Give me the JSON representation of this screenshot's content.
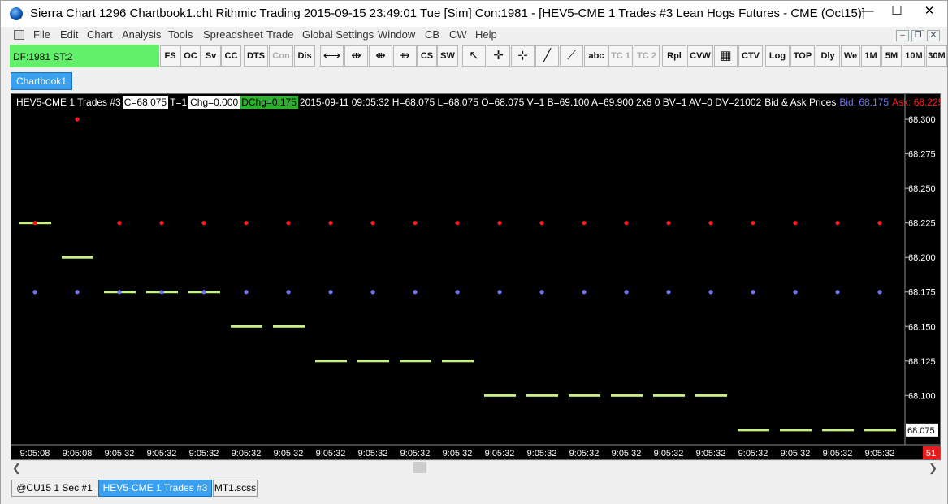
{
  "window": {
    "title": "Sierra Chart 1296 Chartbook1.cht  Rithmic Trading 2015-09-15  23:49:01 Tue [Sim]  Con:1981 - [HEV5-CME  1 Trades  #3  Lean Hogs Futures - CME (Oct15)]",
    "minimize": "—",
    "maximize": "☐",
    "close": "✕"
  },
  "menu": {
    "items": [
      "File",
      "Edit",
      "Chart",
      "Analysis",
      "Tools",
      "Spreadsheet",
      "Trade",
      "Global Settings",
      "Window",
      "CB",
      "CW",
      "Help"
    ],
    "mdi_min": "–",
    "mdi_restore": "❐",
    "mdi_close": "✕"
  },
  "toolbar": {
    "df_status": "DF:1981  ST:2",
    "fs": "FS",
    "oc": "OC",
    "sv": "Sv",
    "cc": "CC",
    "dts": "DTS",
    "con": "Con",
    "dis": "Dis",
    "cs": "CS",
    "sw": "SW",
    "abc": "abc",
    "tc1": "TC 1",
    "tc2": "TC 2",
    "rpl": "Rpl",
    "cvw": "CVW",
    "ctv": "CTV",
    "log": "Log",
    "top": "TOP",
    "dly": "Dly",
    "we": "We",
    "m1": "1M",
    "m5": "5M",
    "m10": "10M",
    "m30": "30M"
  },
  "chartbook_tab": "Chartbook1",
  "chart_info": {
    "symbol": "HEV5-CME  1 Trades  #3",
    "close": "C=68.075",
    "trades": "T=1",
    "chg": "Chg=0.000",
    "dchg": "DChg=0.175",
    "details": "2015-09-11 09:05:32 H=68.075 L=68.075 O=68.075 V=1 B=69.100 A=69.900 2x8 0 BV=1 AV=0 DV=21002",
    "study_name": "Bid & Ask Prices",
    "bid": "Bid: 68.175",
    "ask": "Ask: 68.225"
  },
  "bar_countdown": "51",
  "bottom_tabs": [
    "@CU15  1 Sec  #1",
    "HEV5-CME  1 Trades  #3",
    "MT1.scss"
  ],
  "colors": {
    "background": "#000000",
    "price": "#c8f08a",
    "bid": "#6f74f0",
    "ask": "#ff1a1a",
    "scale_text": "#000000",
    "countdown_bg": "#e61c1c"
  },
  "chart_data": {
    "type": "line",
    "subtype": "OHLC dash per bar with bid/ask dots",
    "ylim": [
      68.0655,
      68.3077
    ],
    "y_ticks": [
      68.3,
      68.275,
      68.25,
      68.225,
      68.2,
      68.175,
      68.15,
      68.125,
      68.1
    ],
    "last_price_label": "68.075",
    "categories": [
      "9:05:08",
      "9:05:08",
      "9:05:32",
      "9:05:32",
      "9:05:32",
      "9:05:32",
      "9:05:32",
      "9:05:32",
      "9:05:32",
      "9:05:32",
      "9:05:32",
      "9:05:32",
      "9:05:32",
      "9:05:32",
      "9:05:32",
      "9:05:32",
      "9:05:32",
      "9:05:32",
      "9:05:32",
      "9:05:32",
      "9:05:32"
    ],
    "series": [
      {
        "name": "Price",
        "values": [
          68.225,
          68.2,
          68.175,
          68.175,
          68.175,
          68.15,
          68.15,
          68.125,
          68.125,
          68.125,
          68.125,
          68.1,
          68.1,
          68.1,
          68.1,
          68.1,
          68.1,
          68.075,
          68.075,
          68.075,
          68.075
        ]
      },
      {
        "name": "Bid",
        "values": [
          68.175,
          68.175,
          68.175,
          68.175,
          68.175,
          68.175,
          68.175,
          68.175,
          68.175,
          68.175,
          68.175,
          68.175,
          68.175,
          68.175,
          68.175,
          68.175,
          68.175,
          68.175,
          68.175,
          68.175,
          68.175
        ]
      },
      {
        "name": "Ask",
        "values": [
          68.225,
          68.3,
          68.225,
          68.225,
          68.225,
          68.225,
          68.225,
          68.225,
          68.225,
          68.225,
          68.225,
          68.225,
          68.225,
          68.225,
          68.225,
          68.225,
          68.225,
          68.225,
          68.225,
          68.225,
          68.225
        ]
      }
    ],
    "grid": false,
    "legend": "none"
  }
}
